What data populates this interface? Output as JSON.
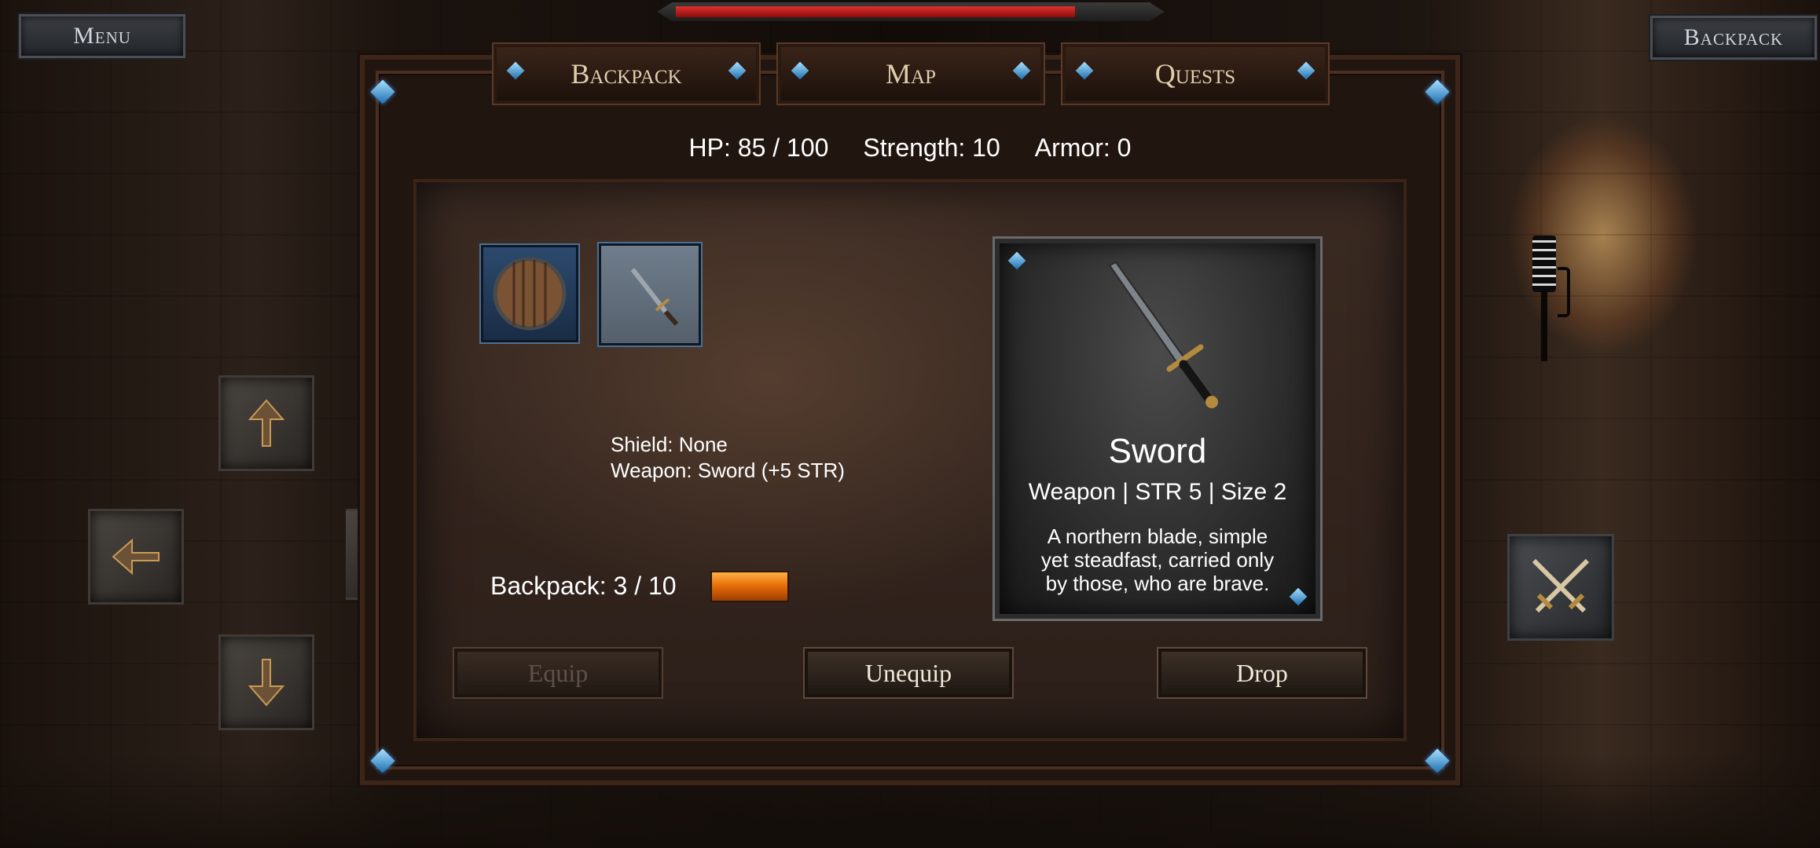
{
  "hud": {
    "menu_label": "Menu",
    "backpack_label": "Backpack",
    "player_health_fraction": 0.85
  },
  "inventory": {
    "tabs": [
      {
        "label": "Backpack"
      },
      {
        "label": "Map"
      },
      {
        "label": "Quests"
      }
    ],
    "stats": {
      "hp": "HP: 85 / 100",
      "strength": "Strength: 10",
      "armor": "Armor: 0"
    },
    "equipped": {
      "shield": "Shield: None",
      "weapon": "Weapon: Sword (+5 STR)"
    },
    "backpack_capacity": "Backpack: 3 / 10",
    "capacity_fraction": 0.3,
    "selected_item": {
      "name": "Sword",
      "meta": "Weapon | STR 5 | Size 2",
      "description": "A northern blade, simple yet steadfast, carried only by those, who are brave."
    },
    "actions": {
      "equip": "Equip",
      "unequip": "Unequip",
      "drop": "Drop"
    }
  },
  "colors": {
    "accent_gem": "#3aa0ff",
    "health_red": "#d2221c",
    "capacity_orange": "#e46a08"
  }
}
